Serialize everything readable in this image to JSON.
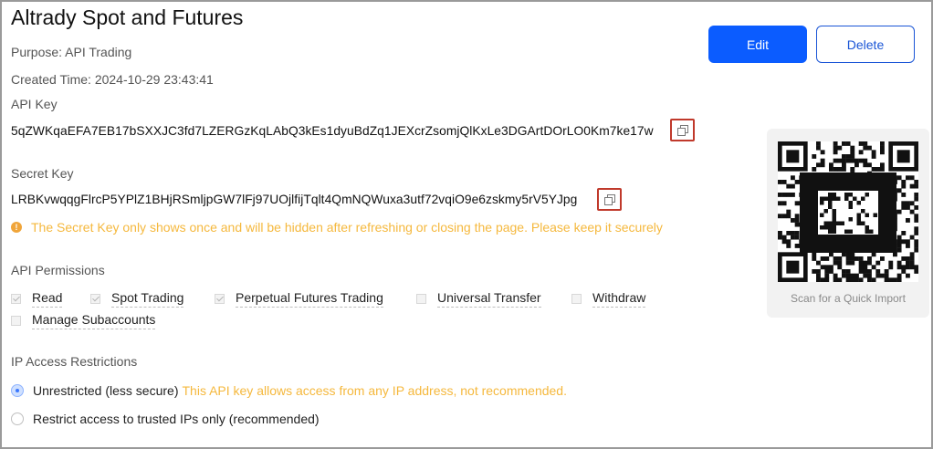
{
  "header": {
    "title": "Altrady Spot and Futures",
    "purpose": "Purpose: API Trading",
    "created_time": "Created Time: 2024-10-29 23:43:41",
    "edit_label": "Edit",
    "delete_label": "Delete"
  },
  "api_key": {
    "label": "API Key",
    "value": "5qZWKqaEFA7EB17bSXXJC3fd7LZERGzKqLAbQ3kEs1dyuBdZq1JEXcrZsomjQlKxLe3DGArtDOrLO0Km7ke17w"
  },
  "secret_key": {
    "label": "Secret Key",
    "value": "LRBKvwqqgFlrcP5YPlZ1BHjRSmljpGW7lFj97UOjlfijTqlt4QmNQWuxa3utf72vqiO9e6zskmy5rV5YJpg",
    "warning": "The Secret Key only shows once and will be hidden after refreshing or closing the page. Please keep it securely"
  },
  "permissions": {
    "label": "API Permissions",
    "items": [
      {
        "label": "Read",
        "checked": true
      },
      {
        "label": "Spot Trading",
        "checked": true
      },
      {
        "label": "Perpetual Futures Trading",
        "checked": true
      },
      {
        "label": "Universal Transfer",
        "checked": false
      },
      {
        "label": "Withdraw",
        "checked": false
      },
      {
        "label": "Manage Subaccounts",
        "checked": false
      }
    ]
  },
  "ip_access": {
    "label": "IP Access Restrictions",
    "option_unrestricted": "Unrestricted (less secure)",
    "option_unrestricted_warning": "This API key allows access from any IP address, not recommended.",
    "option_restricted": "Restrict access to trusted IPs only (recommended)",
    "selected": "unrestricted"
  },
  "qr": {
    "caption": "Scan for a Quick Import"
  },
  "colors": {
    "primary": "#0b5cff",
    "warning": "#f5b83d",
    "highlight_border": "#c0392b"
  }
}
